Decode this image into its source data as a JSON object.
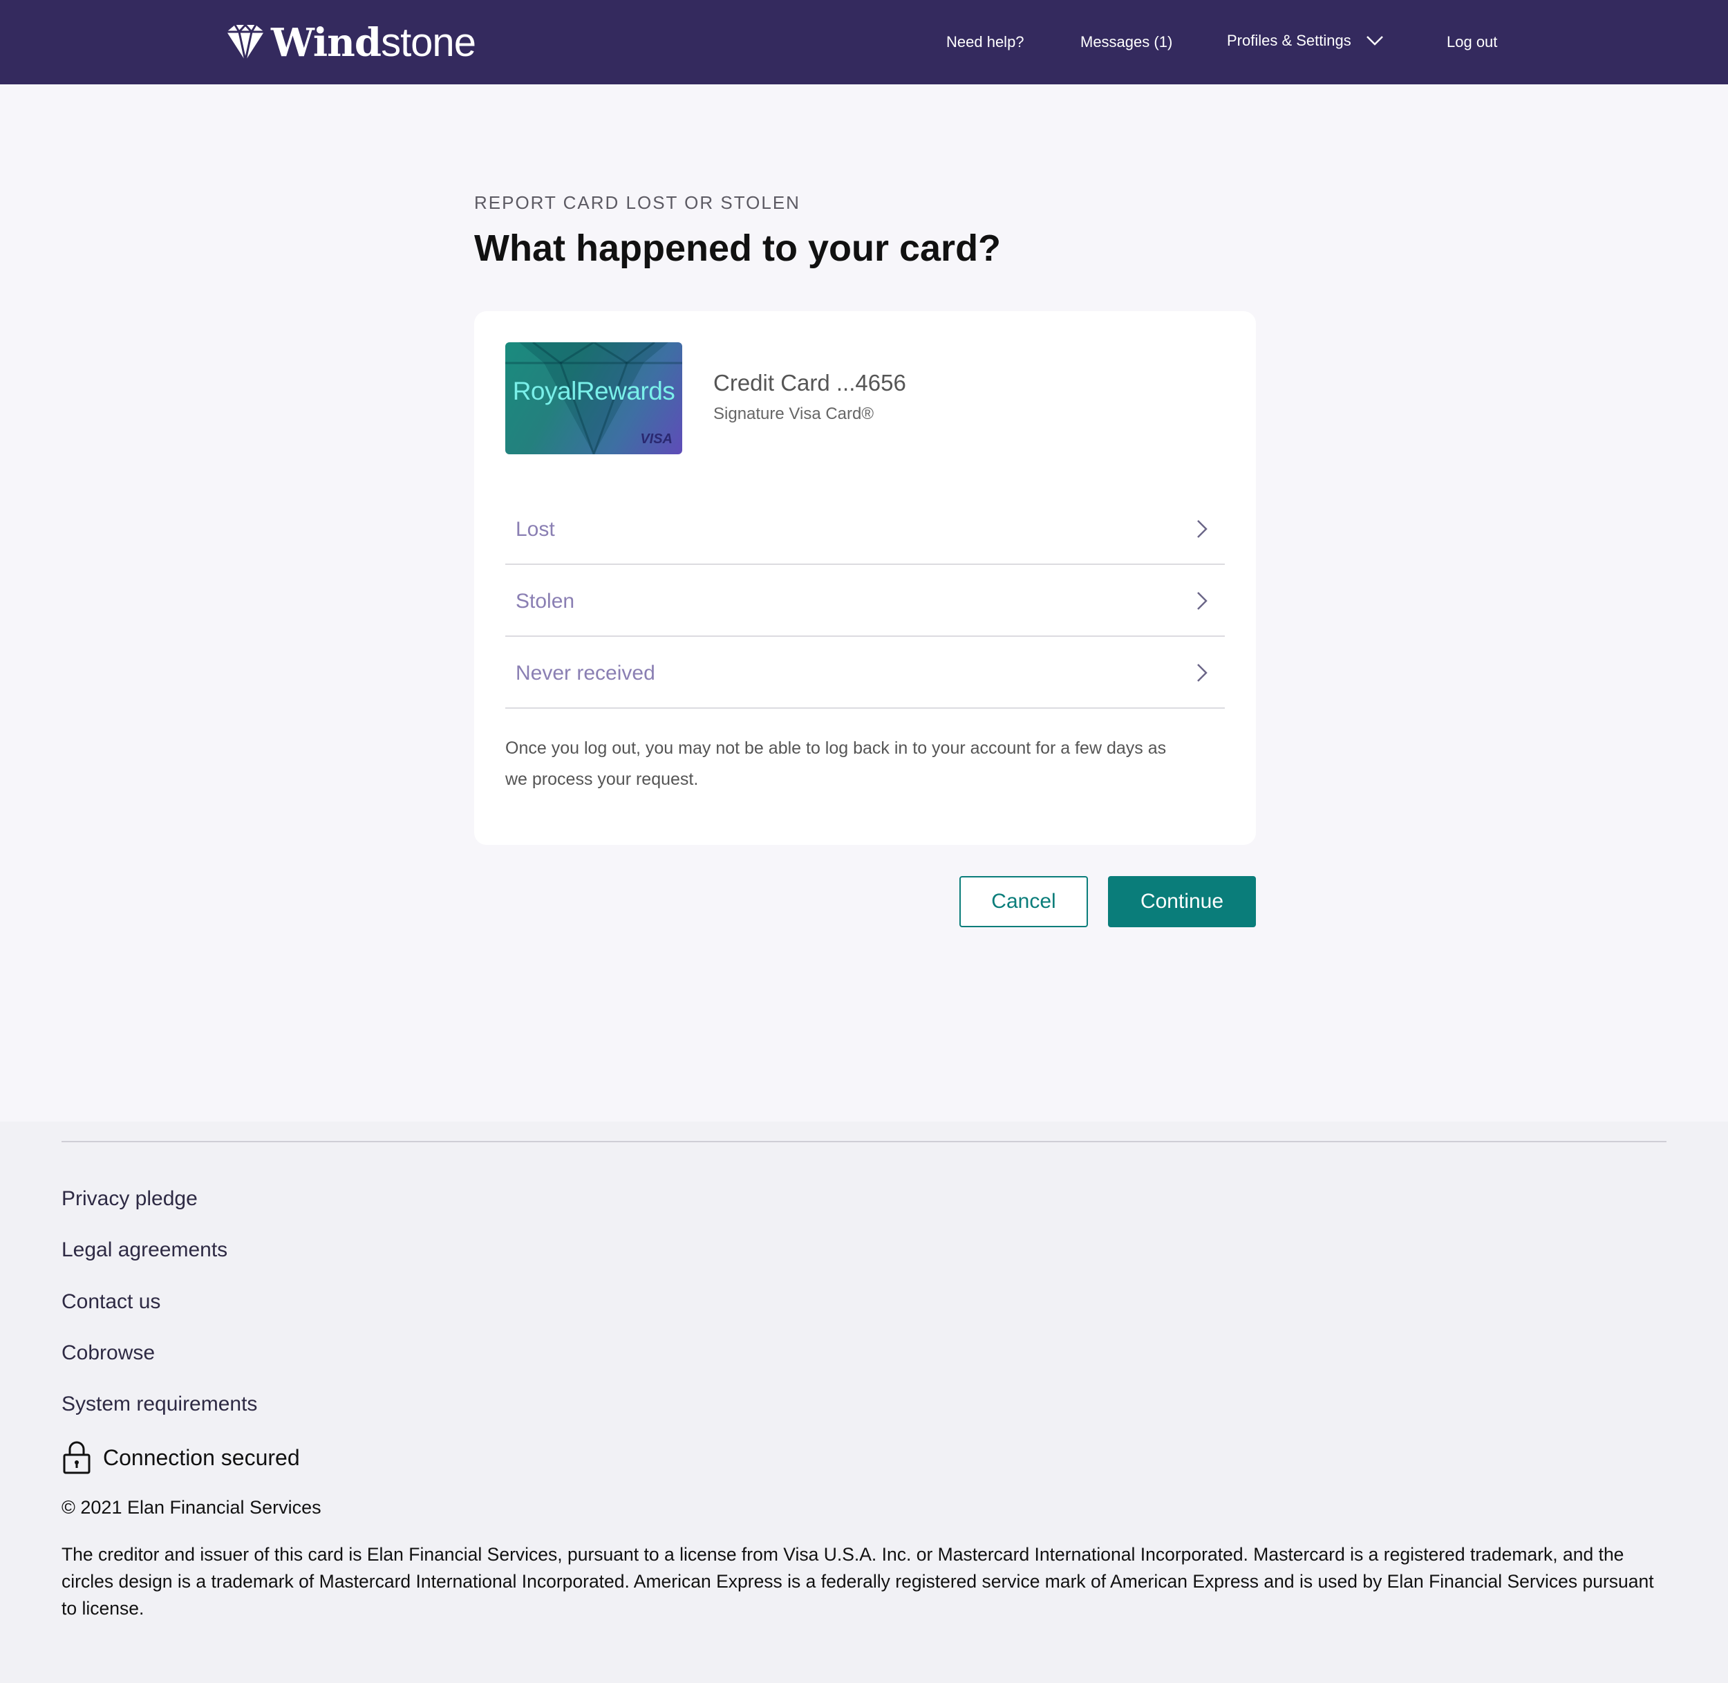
{
  "header": {
    "logo": {
      "bold": "Wind",
      "light": "stone"
    },
    "nav": {
      "help": "Need help?",
      "messages": "Messages (1)",
      "profiles": "Profiles & Settings",
      "logout": "Log out"
    }
  },
  "main": {
    "eyebrow": "REPORT CARD LOST OR STOLEN",
    "title": "What happened to your card?",
    "card": {
      "brand": "RoyalRewards",
      "network": "VISA",
      "name": "Credit Card ...4656",
      "type": "Signature Visa Card®"
    },
    "options": [
      "Lost",
      "Stolen",
      "Never received"
    ],
    "notice": "Once you log out, you may not be able to log back in to your account for a few days as we process your request.",
    "buttons": {
      "cancel": "Cancel",
      "continue": "Continue"
    }
  },
  "footer": {
    "links": [
      "Privacy pledge",
      "Legal agreements",
      "Contact us",
      "Cobrowse",
      "System requirements"
    ],
    "secured": "Connection secured",
    "copyright": "© 2021 Elan Financial Services",
    "legal": "The creditor and issuer of this card is Elan Financial Services, pursuant to a license from Visa U.S.A. Inc. or Mastercard International Incorporated. Mastercard is a registered trademark, and the circles design is a trademark of Mastercard International Incorporated. American Express is a federally registered service mark of American Express and is used by Elan Financial Services pursuant to license."
  },
  "colors": {
    "header_bg": "#342a5e",
    "accent": "#0a7d7a",
    "option_text": "#8a7fb3",
    "page_bg": "#f7f6fa",
    "footer_bg": "#f1f1f5"
  },
  "icons": [
    "diamond-logo-icon",
    "chevron-down-icon",
    "chevron-right-icon",
    "lock-icon"
  ]
}
